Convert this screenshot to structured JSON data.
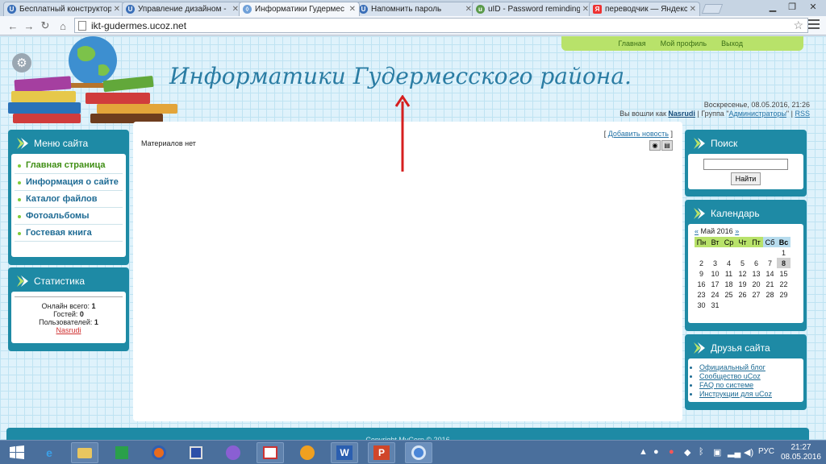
{
  "browser": {
    "tabs": [
      {
        "title": "Бесплатный конструктор",
        "icon": "u-icon",
        "active": false
      },
      {
        "title": "Управление дизайном - ",
        "icon": "u-icon",
        "active": false
      },
      {
        "title": "Информатики Гудермес",
        "icon": "ucoz-icon",
        "active": true
      },
      {
        "title": "Напомнить пароль",
        "icon": "u-icon",
        "active": false
      },
      {
        "title": "uID - Password reminding",
        "icon": "uid-icon",
        "active": false
      },
      {
        "title": "переводчик — Яндекс: н",
        "icon": "yandex-icon",
        "active": false
      }
    ],
    "url": "ikt-gudermes.ucoz.net"
  },
  "site": {
    "top_links": [
      "Главная",
      "Мой профиль",
      "Выход"
    ],
    "title": "Информатики Гудермесского района.",
    "datetime": "Воскресенье, 08.05.2016, 21:26",
    "login": {
      "prefix": "Вы вошли как",
      "user": "Nasrudi",
      "group_prefix": "| Группа \"",
      "group": "Администраторы",
      "group_suffix": "\" |",
      "rss": "RSS"
    }
  },
  "menu": {
    "title": "Меню сайта",
    "items": [
      "Главная страница",
      "Информация о сайте",
      "Каталог файлов",
      "Фотоальбомы",
      "Гостевая книга"
    ]
  },
  "stats": {
    "title": "Статистика",
    "online_label": "Онлайн всего:",
    "online": "1",
    "guests_label": "Гостей:",
    "guests": "0",
    "users_label": "Пользователей:",
    "users": "1",
    "user": "Nasrudi"
  },
  "content": {
    "add_news": "Добавить новость",
    "empty": "Материалов нет"
  },
  "search": {
    "title": "Поиск",
    "button": "Найти"
  },
  "calendar": {
    "title": "Календарь",
    "month": "Май 2016",
    "prev": "«",
    "next": "»",
    "weekdays": [
      "Пн",
      "Вт",
      "Ср",
      "Чт",
      "Пт",
      "Сб",
      "Вс"
    ],
    "weeks": [
      [
        "",
        "",
        "",
        "",
        "",
        "",
        "1"
      ],
      [
        "2",
        "3",
        "4",
        "5",
        "6",
        "7",
        "8"
      ],
      [
        "9",
        "10",
        "11",
        "12",
        "13",
        "14",
        "15"
      ],
      [
        "16",
        "17",
        "18",
        "19",
        "20",
        "21",
        "22"
      ],
      [
        "23",
        "24",
        "25",
        "26",
        "27",
        "28",
        "29"
      ],
      [
        "30",
        "31",
        "",
        "",
        "",
        "",
        ""
      ]
    ],
    "today": "8"
  },
  "friends": {
    "title": "Друзья сайта",
    "links": [
      "Официальный блог",
      "Сообщество uCoz",
      "FAQ по системе",
      "Инструкции для uCoz"
    ]
  },
  "footer": "Copyright MyCorp © 2016",
  "taskbar": {
    "lang": "РУС",
    "time": "21:27",
    "date": "08.05.2016"
  },
  "colors": {
    "accent": "#1e8aa5",
    "green": "#b8e26a",
    "title": "#2a7ca3"
  }
}
